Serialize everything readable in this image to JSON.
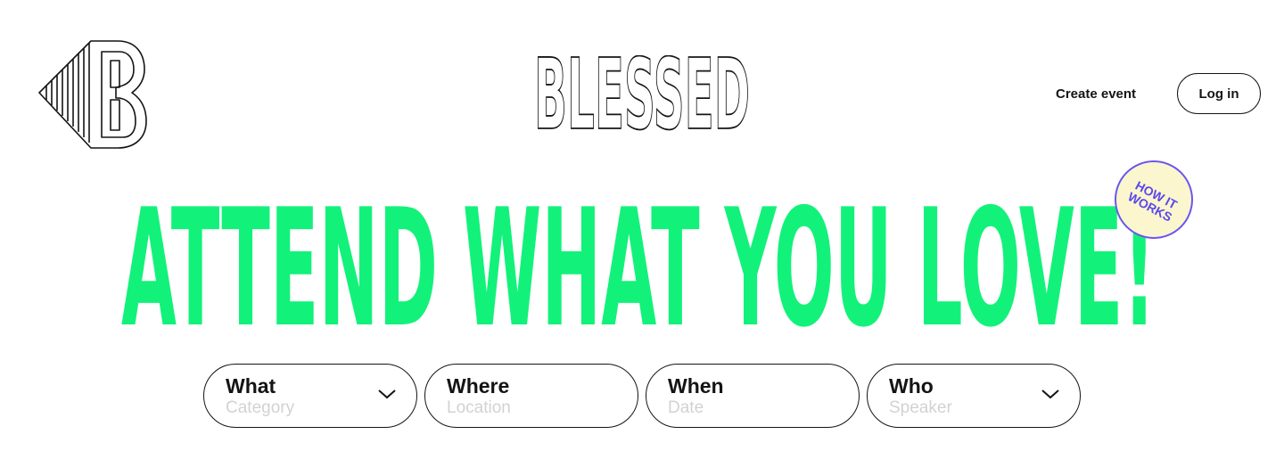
{
  "header": {
    "brand_name": "BLESSED",
    "logo_letter": "B",
    "create_event_label": "Create event",
    "login_label": "Log in"
  },
  "hero": {
    "headline": "ATTEND WHAT YOU LOVE!",
    "badge_line1": "HOW IT",
    "badge_line2": "WORKS"
  },
  "filters": [
    {
      "label": "What",
      "hint": "Category",
      "icon": "chevron-down-icon"
    },
    {
      "label": "Where",
      "hint": "Location"
    },
    {
      "label": "When",
      "hint": "Date"
    },
    {
      "label": "Who",
      "hint": "Speaker",
      "icon": "chevron-down-icon"
    }
  ],
  "colors": {
    "accent_green": "#12f27a",
    "badge_purple": "#5b48ec",
    "badge_fill": "#fbf6cd",
    "ink": "#141414",
    "placeholder": "#d2d2d2"
  }
}
